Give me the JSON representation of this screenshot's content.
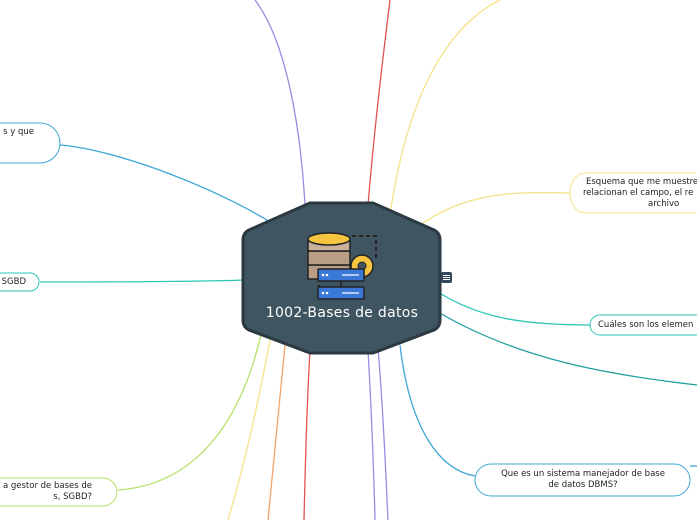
{
  "central": {
    "title": "1002-Bases de datos"
  },
  "nodes": {
    "left_top": "s y que",
    "left_sgbd": "SGBD",
    "left_bottom_line1": "a gestor de bases de",
    "left_bottom_line2": "s, SGBD?",
    "right_schema_line1": "Esquema que me muestre",
    "right_schema_line2": "relacionan el campo, el re",
    "right_schema_line3": "archivo",
    "right_elements": "Cuáles son los elemen",
    "right_dbms_line1": "Que es un sistema manejador de base",
    "right_dbms_line2": "de datos DBMS?"
  },
  "colors": {
    "central_fill": "#3f5561",
    "central_border": "#2b3a42",
    "branch_purple": "#9b8ae0",
    "branch_red": "#e05252",
    "branch_yellow": "#f5e28a",
    "branch_teal": "#2ec4b6",
    "branch_blue": "#3fa7d6",
    "branch_orange": "#f0a46b",
    "branch_green": "#b6e06a"
  }
}
